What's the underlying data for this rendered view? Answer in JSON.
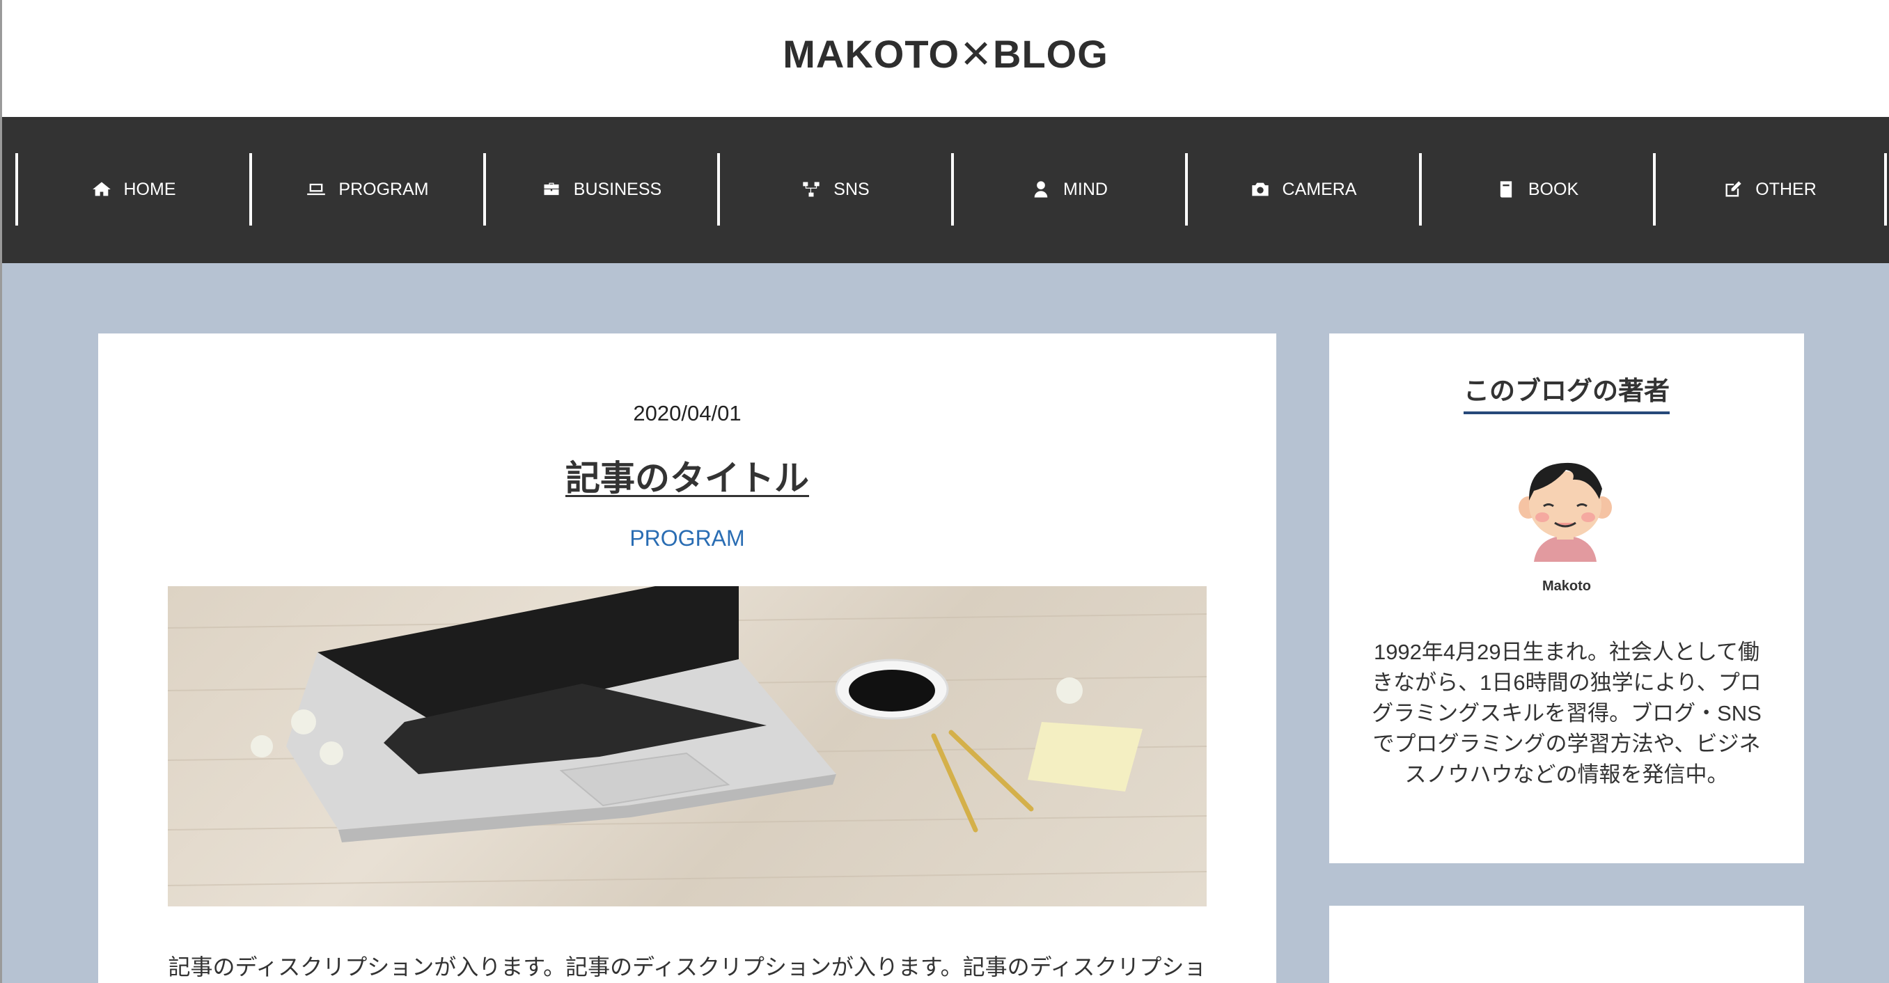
{
  "site": {
    "title": "MAKOTO✕BLOG"
  },
  "nav": {
    "items": [
      {
        "label": "HOME",
        "icon": "home-icon"
      },
      {
        "label": "PROGRAM",
        "icon": "laptop-icon"
      },
      {
        "label": "BUSINESS",
        "icon": "briefcase-icon"
      },
      {
        "label": "SNS",
        "icon": "network-icon"
      },
      {
        "label": "MIND",
        "icon": "person-icon"
      },
      {
        "label": "CAMERA",
        "icon": "camera-icon"
      },
      {
        "label": "BOOK",
        "icon": "book-icon"
      },
      {
        "label": "OTHER",
        "icon": "edit-icon"
      }
    ]
  },
  "post": {
    "date": "2020/04/01",
    "title": "記事のタイトル",
    "category": "PROGRAM",
    "description": "記事のディスクリプションが入ります。記事のディスクリプションが入ります。記事のディスクリプショ"
  },
  "sidebar": {
    "author": {
      "heading": "このブログの著者",
      "name": "Makoto",
      "bio": "1992年4月29日生まれ。社会人として働きながら、1日6時間の独学により、プログラミングスキルを習得。ブログ・SNSでプログラミングの学習方法や、ビジネスノウハウなどの情報を発信中。"
    }
  },
  "colors": {
    "background": "#b6c2d2",
    "nav_background": "#333333",
    "category_link": "#2a6db3",
    "heading_underline": "#27497a"
  }
}
